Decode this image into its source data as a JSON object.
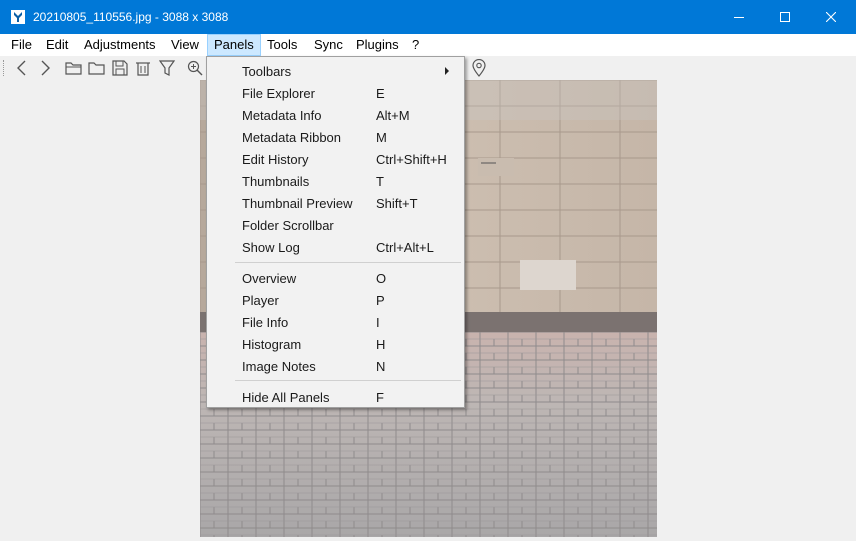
{
  "window": {
    "title": "20210805_110556.jpg - 3088 x 3088",
    "colors": {
      "titlebar": "#0078d7",
      "menu_highlight": "#cce8ff"
    }
  },
  "controls": {
    "minimize_icon": "minimize-icon",
    "maximize_icon": "maximize-icon",
    "close_icon": "close-icon"
  },
  "menubar": {
    "items": [
      {
        "label": "File"
      },
      {
        "label": "Edit"
      },
      {
        "label": "Adjustments"
      },
      {
        "label": "View"
      },
      {
        "label": "Panels",
        "active": true
      },
      {
        "label": "Tools"
      },
      {
        "label": "Sync"
      },
      {
        "label": "Plugins"
      },
      {
        "label": "?"
      }
    ]
  },
  "toolbar": {
    "icons": [
      "back-icon",
      "forward-icon",
      "folder-open-icon",
      "folder-icon",
      "save-icon",
      "delete-icon",
      "filter-icon",
      "zoom-in-icon",
      "location-pin-icon"
    ]
  },
  "panels_menu": {
    "items": [
      {
        "label": "Toolbars",
        "shortcut": "",
        "submenu": true
      },
      {
        "label": "File Explorer",
        "shortcut": "E"
      },
      {
        "label": "Metadata Info",
        "shortcut": "Alt+M"
      },
      {
        "label": "Metadata Ribbon",
        "shortcut": "M"
      },
      {
        "label": "Edit History",
        "shortcut": "Ctrl+Shift+H"
      },
      {
        "label": "Thumbnails",
        "shortcut": "T"
      },
      {
        "label": "Thumbnail Preview",
        "shortcut": "Shift+T"
      },
      {
        "label": "Folder Scrollbar",
        "shortcut": ""
      },
      {
        "label": "Show Log",
        "shortcut": "Ctrl+Alt+L"
      },
      {
        "label": "Overview",
        "shortcut": "O"
      },
      {
        "label": "Player",
        "shortcut": "P"
      },
      {
        "label": "File Info",
        "shortcut": "I"
      },
      {
        "label": "Histogram",
        "shortcut": "H"
      },
      {
        "label": "Image Notes",
        "shortcut": "N"
      },
      {
        "label": "Hide All Panels",
        "shortcut": "F"
      }
    ]
  }
}
